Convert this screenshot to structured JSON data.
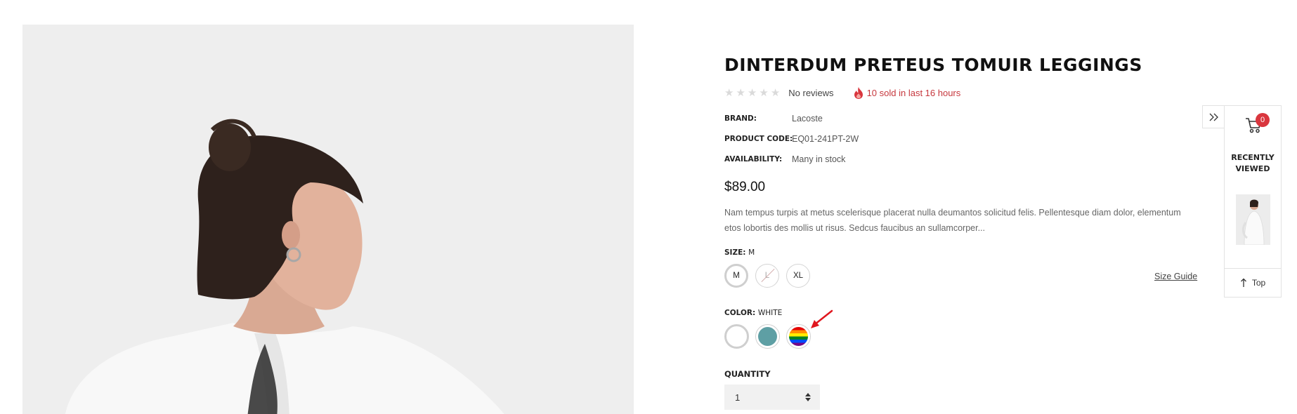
{
  "product": {
    "title": "DINTERDUM PRETEUS TOMUIR LEGGINGS",
    "reviews_text": "No reviews",
    "sold_text": "10 sold in last 16 hours",
    "brand_label": "BRAND:",
    "brand": "Lacoste",
    "code_label": "PRODUCT CODE:",
    "code": "EQ01-241PT-2W",
    "availability_label": "AVAILABILITY:",
    "availability": "Many in stock",
    "price": "$89.00",
    "description": "Nam tempus turpis at metus scelerisque placerat nulla deumantos solicitud felis. Pellentesque diam dolor, elementum etos lobortis des mollis ut risus. Sedcus faucibus an sullamcorper...",
    "size_label": "SIZE:",
    "size_selected": "M",
    "sizes": [
      {
        "label": "M",
        "state": "selected"
      },
      {
        "label": "L",
        "state": "unavailable"
      },
      {
        "label": "XL",
        "state": "available"
      }
    ],
    "size_guide": "Size Guide",
    "color_label": "COLOR:",
    "color_selected": "WHITE",
    "colors": [
      {
        "name": "white",
        "value": "#ffffff",
        "selected": true
      },
      {
        "name": "teal",
        "value": "#5e9fa4",
        "selected": false
      },
      {
        "name": "rainbow",
        "value": "rainbow",
        "selected": false
      }
    ],
    "quantity_label": "QUANTITY",
    "quantity": "1",
    "rating_stars": 5,
    "rating_value": 0
  },
  "sidebar": {
    "cart_count": "0",
    "recently_viewed_line1": "RECENTLY",
    "recently_viewed_line2": "VIEWED",
    "top_label": "Top"
  },
  "colors": {
    "accent_red": "#d9363e",
    "sold_red": "#c6373d",
    "annotation_arrow": "#e0161e",
    "image_bg": "#eeeeee"
  },
  "icons": [
    "star-icon",
    "flame-icon",
    "double-chevron-right-icon",
    "cart-icon",
    "arrow-up-icon",
    "annotation-arrow-icon"
  ]
}
